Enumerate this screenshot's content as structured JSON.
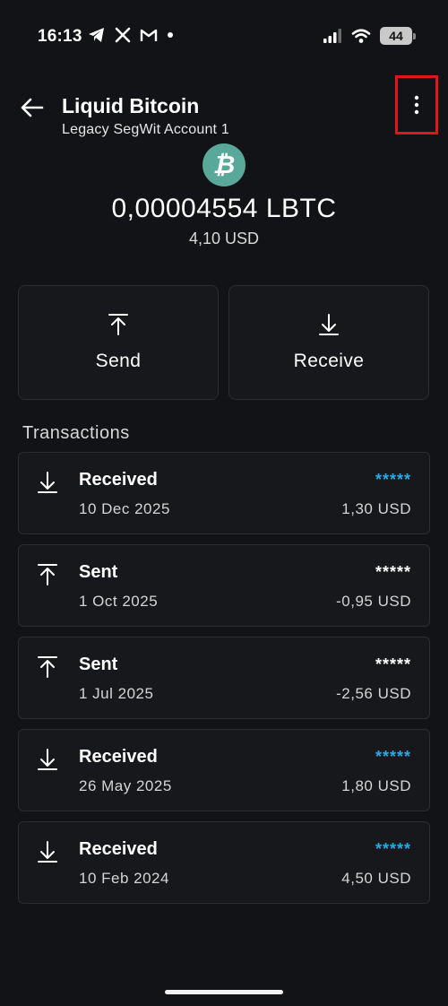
{
  "status_bar": {
    "time": "16:13",
    "notification_icons": [
      "telegram-icon",
      "x-icon",
      "gmail-icon",
      "dot-icon"
    ],
    "battery": "44"
  },
  "header": {
    "title": "Liquid Bitcoin",
    "subtitle": "Legacy SegWit Account 1",
    "back_icon": "arrow-left-icon",
    "more_icon": "more-vertical-icon"
  },
  "account": {
    "coin_symbol": "₿",
    "coin_color": "#59a89a",
    "balance": "0,00004554 LBTC",
    "fiat_balance": "4,10 USD"
  },
  "actions": {
    "send_label": "Send",
    "receive_label": "Receive"
  },
  "transactions": {
    "title": "Transactions",
    "items": [
      {
        "type": "Received",
        "date": "10 Dec 2025",
        "hidden": "*****",
        "fiat": "1,30 USD",
        "direction": "in"
      },
      {
        "type": "Sent",
        "date": "1 Oct 2025",
        "hidden": "*****",
        "fiat": "-0,95 USD",
        "direction": "out"
      },
      {
        "type": "Sent",
        "date": "1 Jul 2025",
        "hidden": "*****",
        "fiat": "-2,56 USD",
        "direction": "out"
      },
      {
        "type": "Received",
        "date": "26 May 2025",
        "hidden": "*****",
        "fiat": "1,80 USD",
        "direction": "in"
      },
      {
        "type": "Received",
        "date": "10 Feb 2024",
        "hidden": "*****",
        "fiat": "4,50 USD",
        "direction": "in"
      }
    ]
  },
  "colors": {
    "background": "#121316",
    "card": "#17181b",
    "received_accent": "#2aa8e8",
    "highlight_box": "#e0161b"
  }
}
